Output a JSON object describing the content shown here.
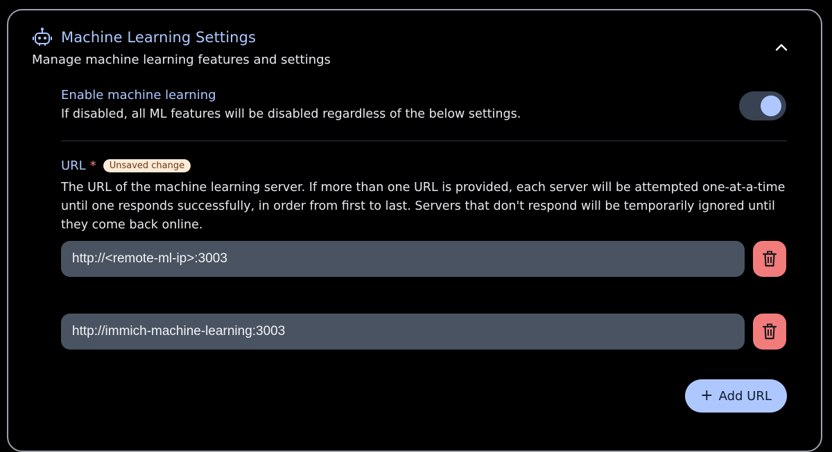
{
  "section": {
    "title": "Machine Learning Settings",
    "subtitle": "Manage machine learning features and settings",
    "icon": "robot-icon"
  },
  "enable_ml": {
    "label": "Enable machine learning",
    "description": "If disabled, all ML features will be disabled regardless of the below settings.",
    "enabled": true
  },
  "url_setting": {
    "label": "URL",
    "required_marker": "*",
    "badge": "Unsaved change",
    "description": "The URL of the machine learning server. If more than one URL is provided, each server will be attempted one-at-a-time until one responds successfully, in order from first to last. Servers that don't respond will be temporarily ignored until they come back online.",
    "urls": [
      {
        "value": "http://<remote-ml-ip>:3003"
      },
      {
        "value": "http://immich-machine-learning:3003"
      }
    ],
    "add_label": "Add URL",
    "add_icon": "+"
  },
  "colors": {
    "accent": "#aec8ff",
    "danger": "#f27c7c",
    "input_bg": "#4a5361"
  }
}
